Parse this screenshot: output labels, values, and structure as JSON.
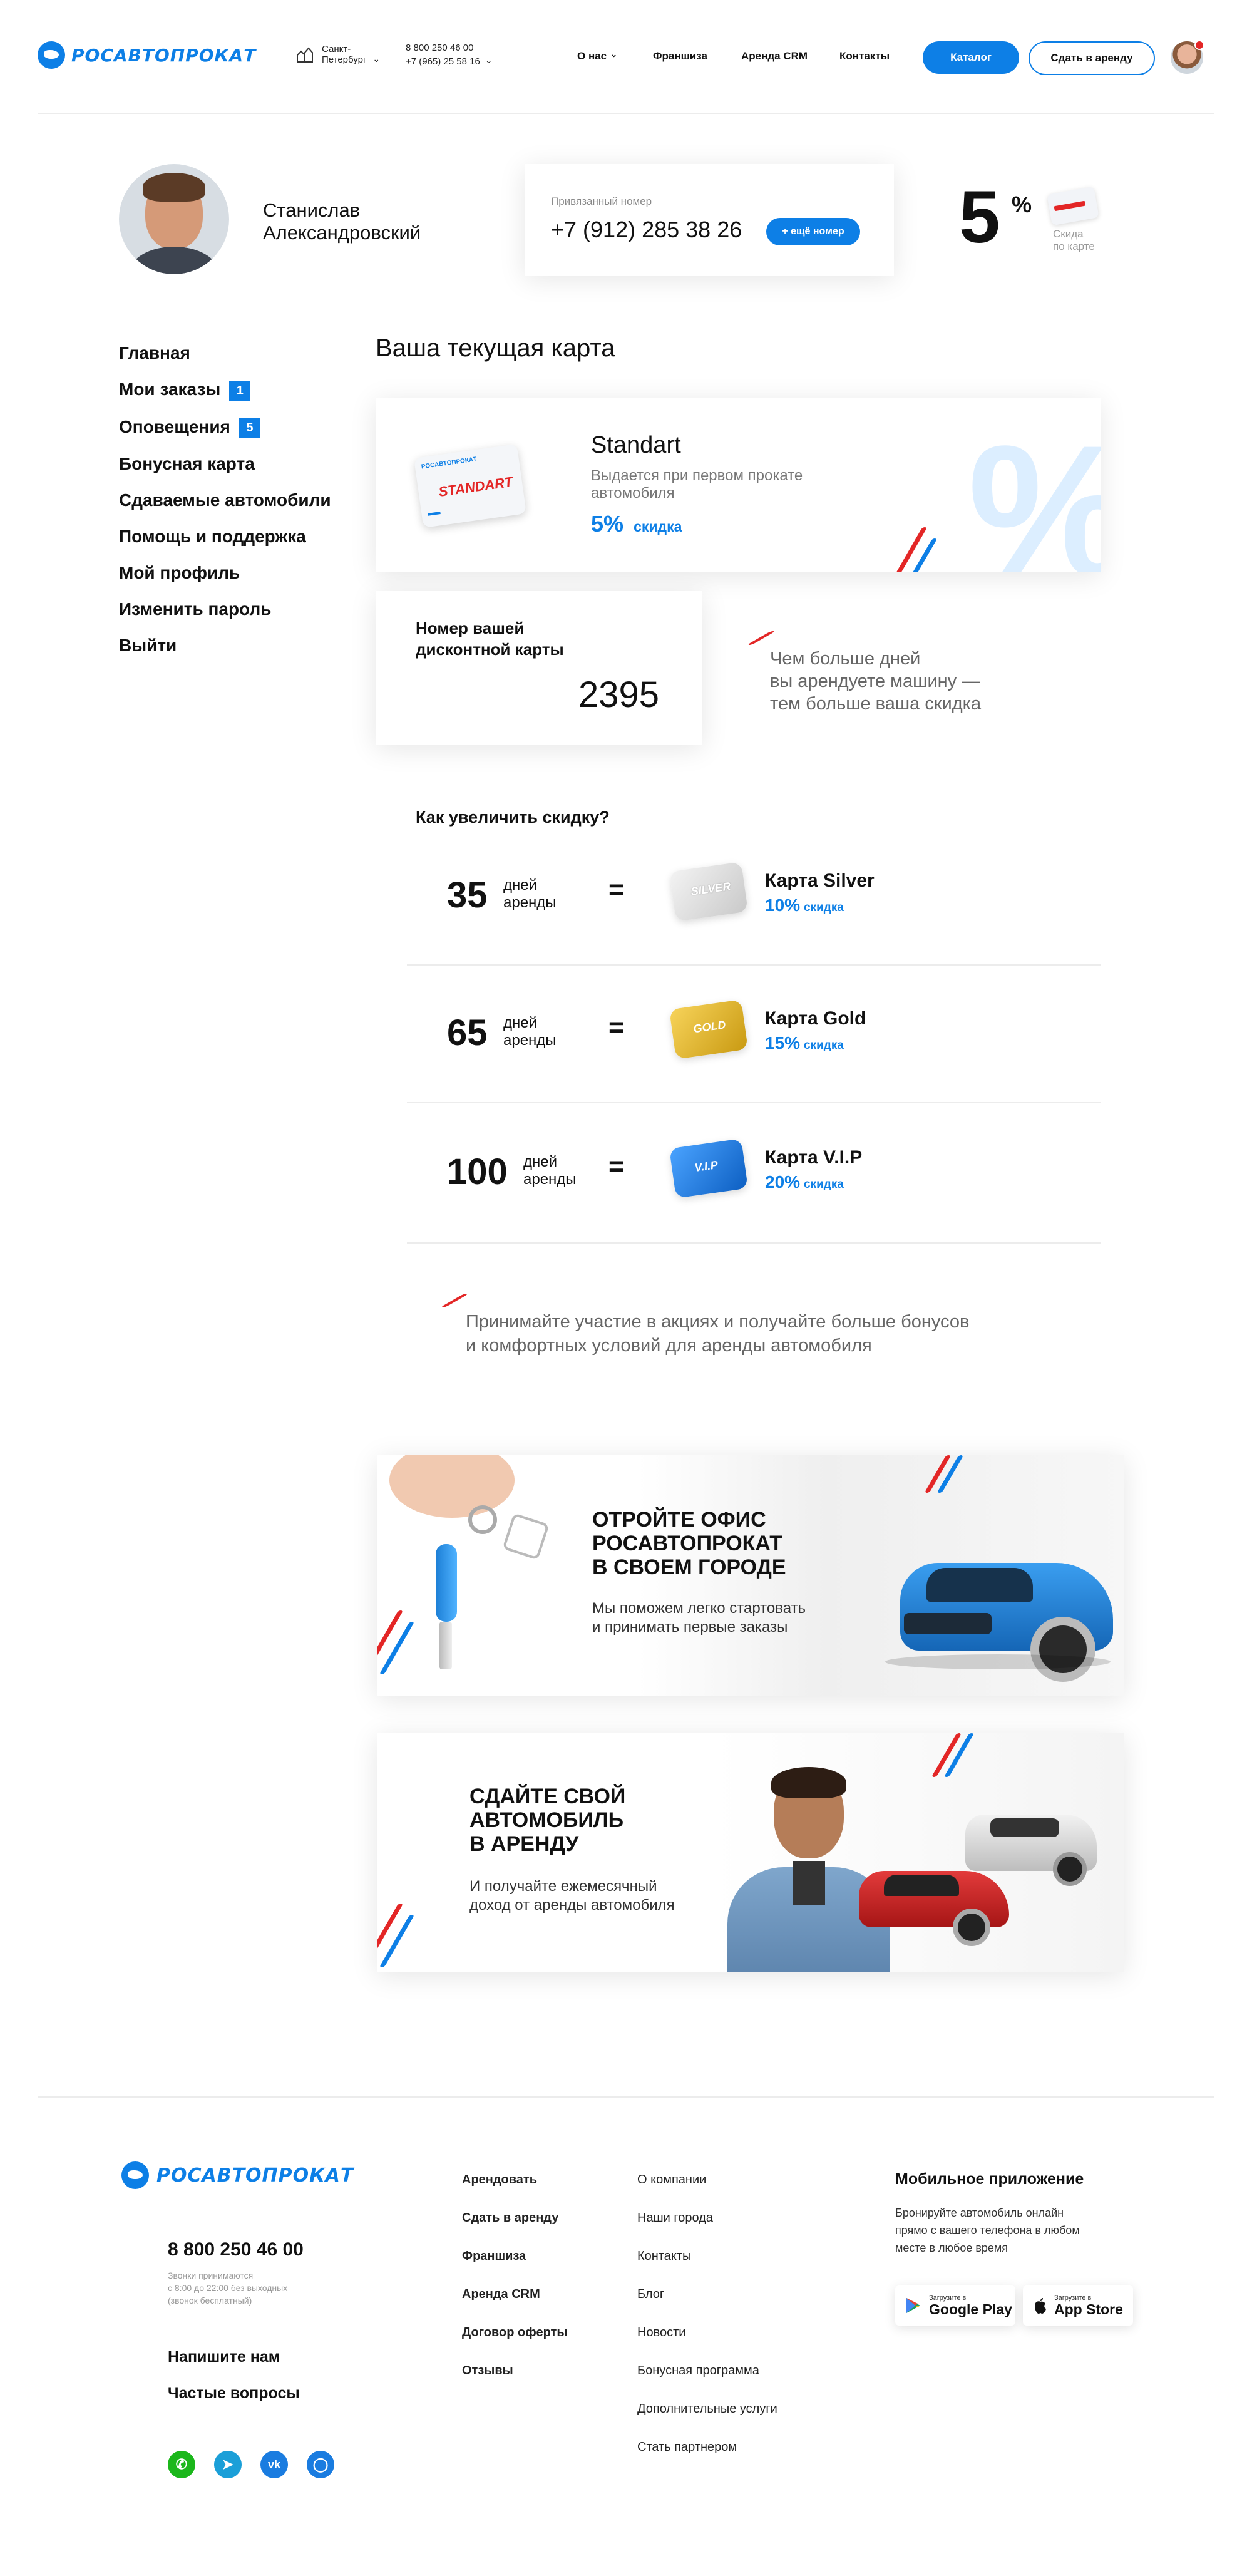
{
  "header": {
    "logo": "РОСАВТОПРОКАТ",
    "city": [
      "Санкт-",
      "Петербург"
    ],
    "phones": [
      "8 800 250 46 00",
      "+7 (965) 25 58 16"
    ],
    "nav": [
      "О нас",
      "Франшиза",
      "Аренда CRM",
      "Контакты"
    ],
    "catalog_btn": "Каталог",
    "rent_btn": "Сдать в аренду"
  },
  "profile": {
    "name_line1": "Станислав",
    "name_line2": "Александровский",
    "phone_label": "Привязанный номер",
    "phone": "+7 (912) 285 38 26",
    "add_phone": "+ ещё номер",
    "discount": "5",
    "discount_sign": "%",
    "discount_caption1": "Скида",
    "discount_caption2": "по карте"
  },
  "menu": [
    {
      "label": "Главная"
    },
    {
      "label": "Мои заказы",
      "badge": "1"
    },
    {
      "label": "Оповещения",
      "badge": "5"
    },
    {
      "label": "Бонусная карта"
    },
    {
      "label": "Сдаваемые автомобили"
    },
    {
      "label": "Помощь и поддержка"
    },
    {
      "label": "Мой профиль"
    },
    {
      "label": "Изменить пароль"
    },
    {
      "label": "Выйти"
    }
  ],
  "current_card": {
    "heading": "Ваша текущая карта",
    "name": "Standart",
    "desc": "Выдается при первом прокате автомобиля",
    "pct": "5%",
    "pct_word": "скидка",
    "card_label": "STANDART",
    "card_brand": "РОСАВТОПРОКАТ"
  },
  "discount_number": {
    "label_line1": "Номер вашей",
    "label_line2": "дисконтной карты",
    "number": "2395",
    "note_line1": "Чем больше дней",
    "note_line2": "вы арендуете машину —",
    "note_line3": "тем больше ваша скидка"
  },
  "increase": {
    "heading": "Как увеличить скидку?",
    "levels": [
      {
        "days": "35",
        "days_w1": "дней",
        "days_w2": "аренды",
        "eq": "=",
        "card": "Карта Silver",
        "pct": "10%",
        "pct_word": "скидка",
        "card_label": "SILVER",
        "color": "#d9d9d9"
      },
      {
        "days": "65",
        "days_w1": "дней",
        "days_w2": "аренды",
        "eq": "=",
        "card": "Карта Gold",
        "pct": "15%",
        "pct_word": "скидка",
        "card_label": "GOLD",
        "color": "#e5b62a"
      },
      {
        "days": "100",
        "days_w1": "дней",
        "days_w2": "аренды",
        "eq": "=",
        "card": "Карта V.I.P",
        "pct": "20%",
        "pct_word": "скидка",
        "card_label": "V.I.P",
        "color": "#1f7be0"
      }
    ],
    "promo_line1": "Принимайте участие в акциях и получайте больше бонусов",
    "promo_line2": "и комфортных условий для аренды автомобиля"
  },
  "banner1": {
    "title_line1": "ОТРОЙТЕ ОФИС",
    "title_line2": "РОСАВТОПРОКАТ",
    "title_line3": "В СВОЕМ ГОРОДЕ",
    "sub_line1": "Мы поможем легко стартовать",
    "sub_line2": "и принимать первые заказы"
  },
  "banner2": {
    "title_line1": "СДАЙТЕ СВОЙ",
    "title_line2": "АВТОМОБИЛЬ",
    "title_line3": "В АРЕНДУ",
    "sub_line1": "И получайте ежемесячный",
    "sub_line2": "доход от аренды автомобиля"
  },
  "footer": {
    "logo": "РОСАВТОПРОКАТ",
    "phone": "8 800 250 46 00",
    "hours_line1": "Звонки принимаются",
    "hours_line2": "с 8:00 до 22:00 без выходных",
    "hours_line3": "(звонок бесплатный)",
    "write_us": "Напишите нам",
    "faq": "Частые вопросы",
    "col1": [
      "Арендовать",
      "Сдать в аренду",
      "Франшиза",
      "Аренда CRM",
      "Договор оферты",
      "Отзывы"
    ],
    "col2": [
      "О компании",
      "Наши города",
      "Контакты",
      "Блог",
      "Новости",
      "Бонусная программа",
      "Дополнительные услуги",
      "Стать партнером"
    ],
    "app_title": "Мобильное приложение",
    "app_line1": "Бронируйте автомобиль онлайн",
    "app_line2": "прямо с вашего телефона в любом",
    "app_line3": "месте в любое время",
    "gp_small": "Загрузите в",
    "gp_big": "Google Play",
    "as_small": "Загрузите в",
    "as_big": "App Store"
  },
  "colors": {
    "accent": "#0d7fe6",
    "red": "#e32626"
  }
}
